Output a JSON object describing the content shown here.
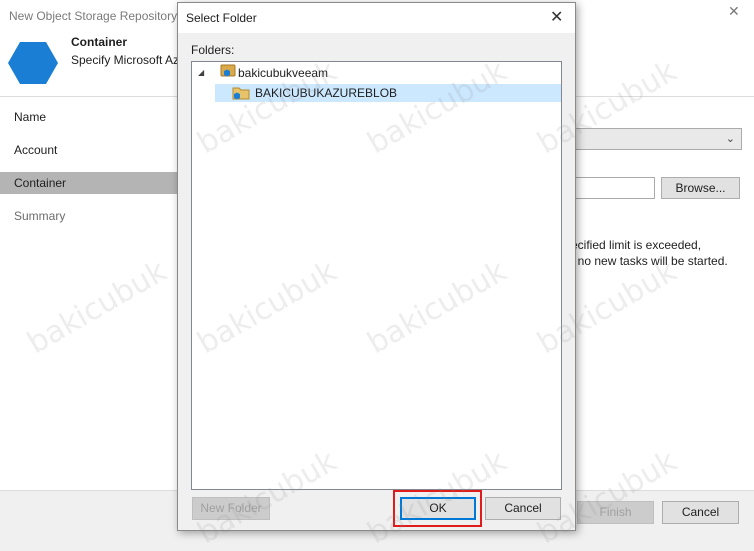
{
  "wizard": {
    "title": "New Object Storage Repository",
    "close_glyph": "✕",
    "header_title": "Container",
    "header_subtitle": "Specify Microsoft Az",
    "steps": [
      "Name",
      "Account",
      "Container",
      "Summary"
    ],
    "selected_step": "Container",
    "browse_label": "Browse...",
    "limit_text_1": "ecified limit is exceeded,",
    "limit_text_2": "t no new tasks will be started.",
    "finish_label": "Finish",
    "cancel_label": "Cancel",
    "accent_color": "#1a7fd4"
  },
  "dialog": {
    "title": "Select Folder",
    "close_glyph": "✕",
    "folders_label": "Folders:",
    "tree": [
      {
        "label": "bakicubukveeam",
        "expanded": true,
        "level": 0
      },
      {
        "label": "BAKICUBUKAZUREBLOB",
        "selected": true,
        "level": 1
      }
    ],
    "new_folder_label": "New Folder",
    "ok_label": "OK",
    "cancel_label": "Cancel",
    "highlight_color": "#e01b1b"
  },
  "watermark": "bakicubuk"
}
